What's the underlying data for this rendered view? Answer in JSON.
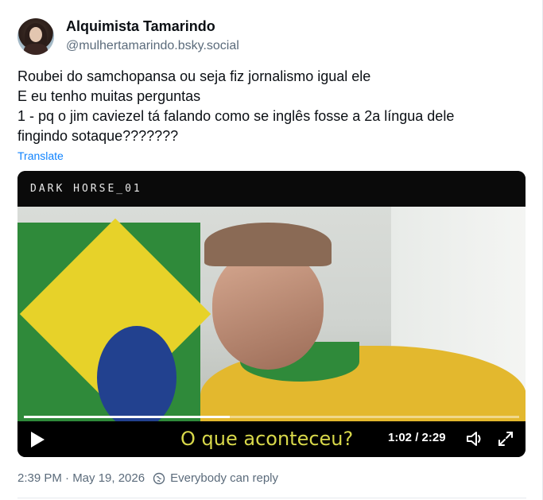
{
  "author": {
    "display_name": "Alquimista Tamarindo",
    "handle": "@mulhertamarindo.bsky.social",
    "avatar_icon": "avatar-photo"
  },
  "post": {
    "lines": [
      "Roubei do samchopansa ou seja fiz jornalismo igual ele",
      "E eu tenho muitas perguntas",
      "1 - pq o jim caviezel tá falando como se inglês fosse a 2a língua dele",
      "fingindo sotaque???????"
    ],
    "translate_label": "Translate"
  },
  "video": {
    "title": "DARK HORSE_01",
    "subtitle": "O que aconteceu?",
    "time_display": "1:02 / 2:29",
    "progress_fraction": 0.416,
    "icons": [
      "play-icon",
      "volume-icon",
      "fullscreen-icon"
    ]
  },
  "meta": {
    "timestamp": "2:39 PM · May 19, 2026",
    "reply_setting": "Everybody can reply",
    "reply_icon": "globe-reply-icon"
  },
  "colors": {
    "link": "#1083fe",
    "subtitle": "#d8d84a",
    "muted": "#5b6b7b"
  }
}
